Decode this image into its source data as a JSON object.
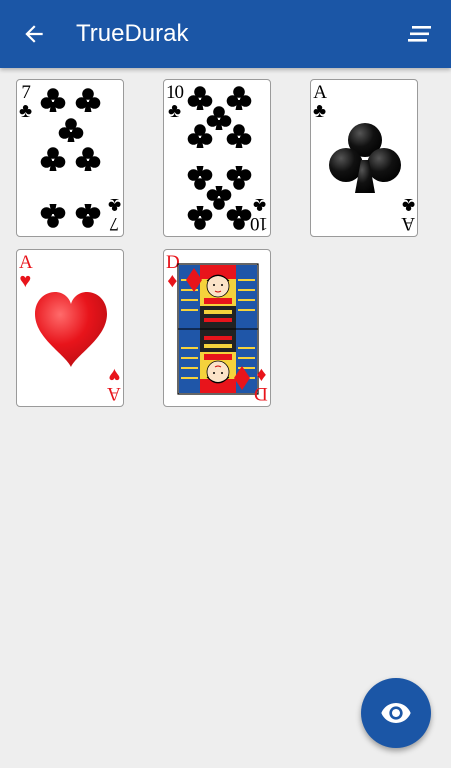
{
  "app_bar": {
    "title": "TrueDurak",
    "back_icon": "arrow-left-icon",
    "menu_icon": "sort-lines-icon",
    "color": "#1b56a6"
  },
  "cards": [
    {
      "rank": "7",
      "suit": "♣",
      "suit_name": "clubs",
      "color": "#000000"
    },
    {
      "rank": "10",
      "suit": "♣",
      "suit_name": "clubs",
      "color": "#000000"
    },
    {
      "rank": "A",
      "suit": "♣",
      "suit_name": "clubs",
      "color": "#000000"
    },
    {
      "rank": "A",
      "suit": "♥",
      "suit_name": "hearts",
      "color": "#e8141b"
    },
    {
      "rank": "D",
      "suit": "♦",
      "suit_name": "diamonds",
      "color": "#e8141b"
    }
  ],
  "fab": {
    "icon": "eye-icon",
    "color": "#1b56a6"
  }
}
